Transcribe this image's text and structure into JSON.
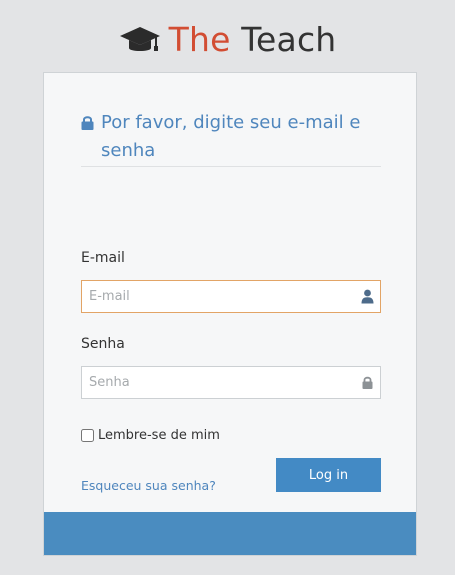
{
  "brand": {
    "the": "The",
    "teach": " Teach",
    "logo_icon": "graduation-cap-icon"
  },
  "card": {
    "title": "Por favor, digite seu e-mail e senha",
    "title_icon": "lock-icon",
    "email_label": "E-mail",
    "email_placeholder": "E-mail",
    "email_value": "",
    "email_icon": "user-icon",
    "password_label": "Senha",
    "password_placeholder": "Senha",
    "password_value": "",
    "password_icon": "lock-icon",
    "remember_label": "Lembre-se de mim",
    "remember_checked": false,
    "forgot_link": "Esqueceu sua senha?",
    "login_button": "Log in"
  },
  "colors": {
    "brand_accent": "#d24d33",
    "link_blue": "#4f86bd",
    "button_blue": "#438ac5",
    "footer_blue": "#4a8cc0",
    "focus_border": "#e2a466"
  }
}
